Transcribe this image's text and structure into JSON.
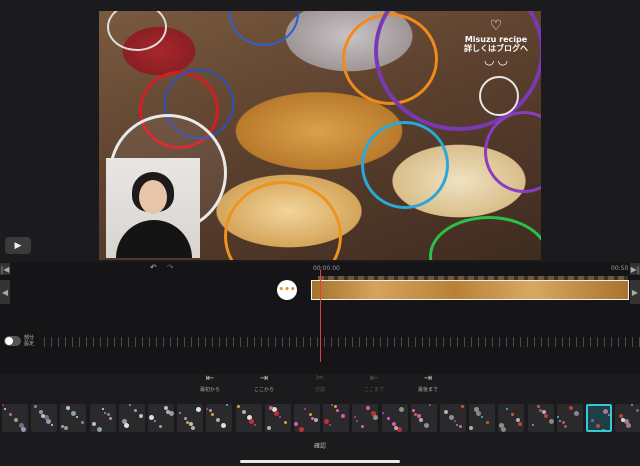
{
  "preview": {
    "logo_line1": "Misuzu recipe",
    "logo_line2": "詳しくはブログへ"
  },
  "timeline": {
    "time_current": "00:00.00",
    "time_end": "00:50"
  },
  "partial_setting": {
    "label": "部分\n設定"
  },
  "tools": {
    "from_start": "最初から",
    "from_here": "ここから",
    "split": "分割",
    "to_here": "ここまで",
    "to_end": "最後まで"
  },
  "effects": {
    "selected_index": 20,
    "count": 22
  },
  "confirm_label": "確認",
  "colors": {
    "accent": "#38c7d8",
    "playhead": "#e04040",
    "clip": "#d6a35d"
  },
  "icons": {
    "play": "play-icon",
    "undo": "undo-icon",
    "redo": "redo-icon",
    "handle": "drag-handle-icon"
  }
}
